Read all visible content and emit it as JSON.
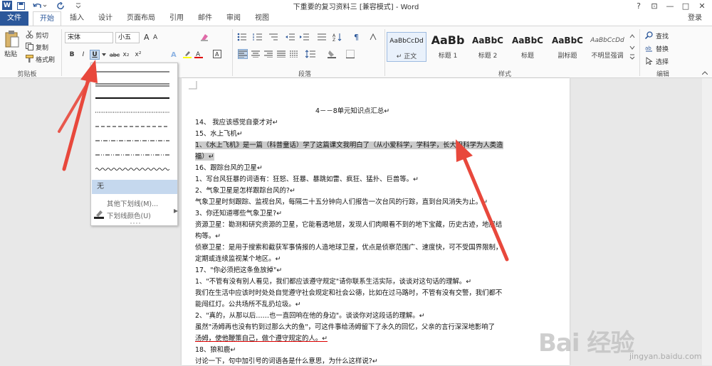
{
  "titlebar": {
    "app_letter": "W",
    "doc_title": "下重要的复习资料三 [兼容模式] - Word",
    "help": "?",
    "ribbon_opts": "⊡",
    "minimize": "—",
    "restore": "□",
    "close": "✕"
  },
  "tabs": [
    {
      "label": "文件"
    },
    {
      "label": "开始"
    },
    {
      "label": "插入"
    },
    {
      "label": "设计"
    },
    {
      "label": "页面布局"
    },
    {
      "label": "引用"
    },
    {
      "label": "邮件"
    },
    {
      "label": "审阅"
    },
    {
      "label": "视图"
    }
  ],
  "login_label": "登录",
  "clipboard": {
    "paste": "粘贴",
    "cut": "剪切",
    "copy": "复制",
    "format_painter": "格式刷",
    "group": "剪贴板"
  },
  "font": {
    "name": "宋体",
    "size": "小五",
    "grow": "A",
    "shrink": "A",
    "bold": "B",
    "italic": "I",
    "underline": "U",
    "strike": "abc",
    "sub": "x₂",
    "sup": "x²"
  },
  "paragraph_group": "段落",
  "styles": {
    "group": "样式",
    "items": [
      {
        "sample": "AaBbCcDd",
        "name": "↵ 正文"
      },
      {
        "sample": "AaBb",
        "name": "标题 1"
      },
      {
        "sample": "AaBbC",
        "name": "标题 2"
      },
      {
        "sample": "AaBbC",
        "name": "标题"
      },
      {
        "sample": "AaBbC",
        "name": "副标题"
      },
      {
        "sample": "AaBbCcDd",
        "name": "不明显强调"
      }
    ]
  },
  "editing": {
    "group": "编辑",
    "find": "查找",
    "replace": "替换",
    "select": "选择"
  },
  "underline_menu": {
    "none": "无",
    "more": "其他下划线(M)...",
    "color": "下划线颜色(U)"
  },
  "document": {
    "lines": [
      "4－－8单元知识点汇总↵",
      "14、 我应该感觉自豪才对↵",
      "15、水上飞机↵",
      "1、《水上飞机》是一篇（科普童话）学了这篇课文我明白了（从小爱科学，学科学，长大用科学为人类造",
      "福）↵",
      "16、跟踪台风的卫星↵",
      "1、写台风狂暴的词语有：狂怒、狂暴、暴跳如雷、疯狂、猛扑、巨兽等。↵",
      "2、气象卫星是怎样跟踪台风的?↵",
      "气象卫星时刻跟踪、监视台风，每隔二十五分钟向人们报告一次台风的行踪，直到台风消失为止。↵",
      "3、你还知道哪些气象卫星?↵",
      "资源卫星：勘测和研究资源的卫星，它能看透地层，发现人们肉眼看不到的地下宝藏，历史古迹，地层结",
      "构等。↵",
      "侦察卫星：是用于搜索和截获军事情报的人造地球卫星，优点是侦察范围广、速度快，可不受国界限制，",
      "定期或连续监视某个地区。↵",
      "17、\"你必须把这条鱼放掉\"↵",
      "1、\"不管有没有别人看见，我们都应该遵守规定\"请你联系生活实际，谈谈对这句话的理解。↵",
      "我们在生活中应该时时处处自觉遵守社会规定和社会公德，比如在过马路时，不管有没有交警，我们都不",
      "能闯红灯。公共场所不乱扔垃圾。↵",
      "2、\"真的，从那以后……也一直回响在他的身边\"。谈谈你对这段话的理解。↵",
      "虽然\"汤姆再也没有钓到过那么大的鱼\"，可这件事给汤姆留下了永久的回忆，父亲的言行深深地影响了",
      "汤姆，使他鞭策自己，做个遵守规定的人。↵",
      "18、狼和鹿↵",
      "讨论一下，句中加引号的词语各是什么意思，为什么这样说?↵"
    ]
  },
  "watermark": {
    "main": "Bai 经验",
    "sub": "jingyan.baidu.com"
  },
  "colors": {
    "accent": "#2b579a",
    "arrow": "#e8483c",
    "highlight": "#cccccc"
  }
}
